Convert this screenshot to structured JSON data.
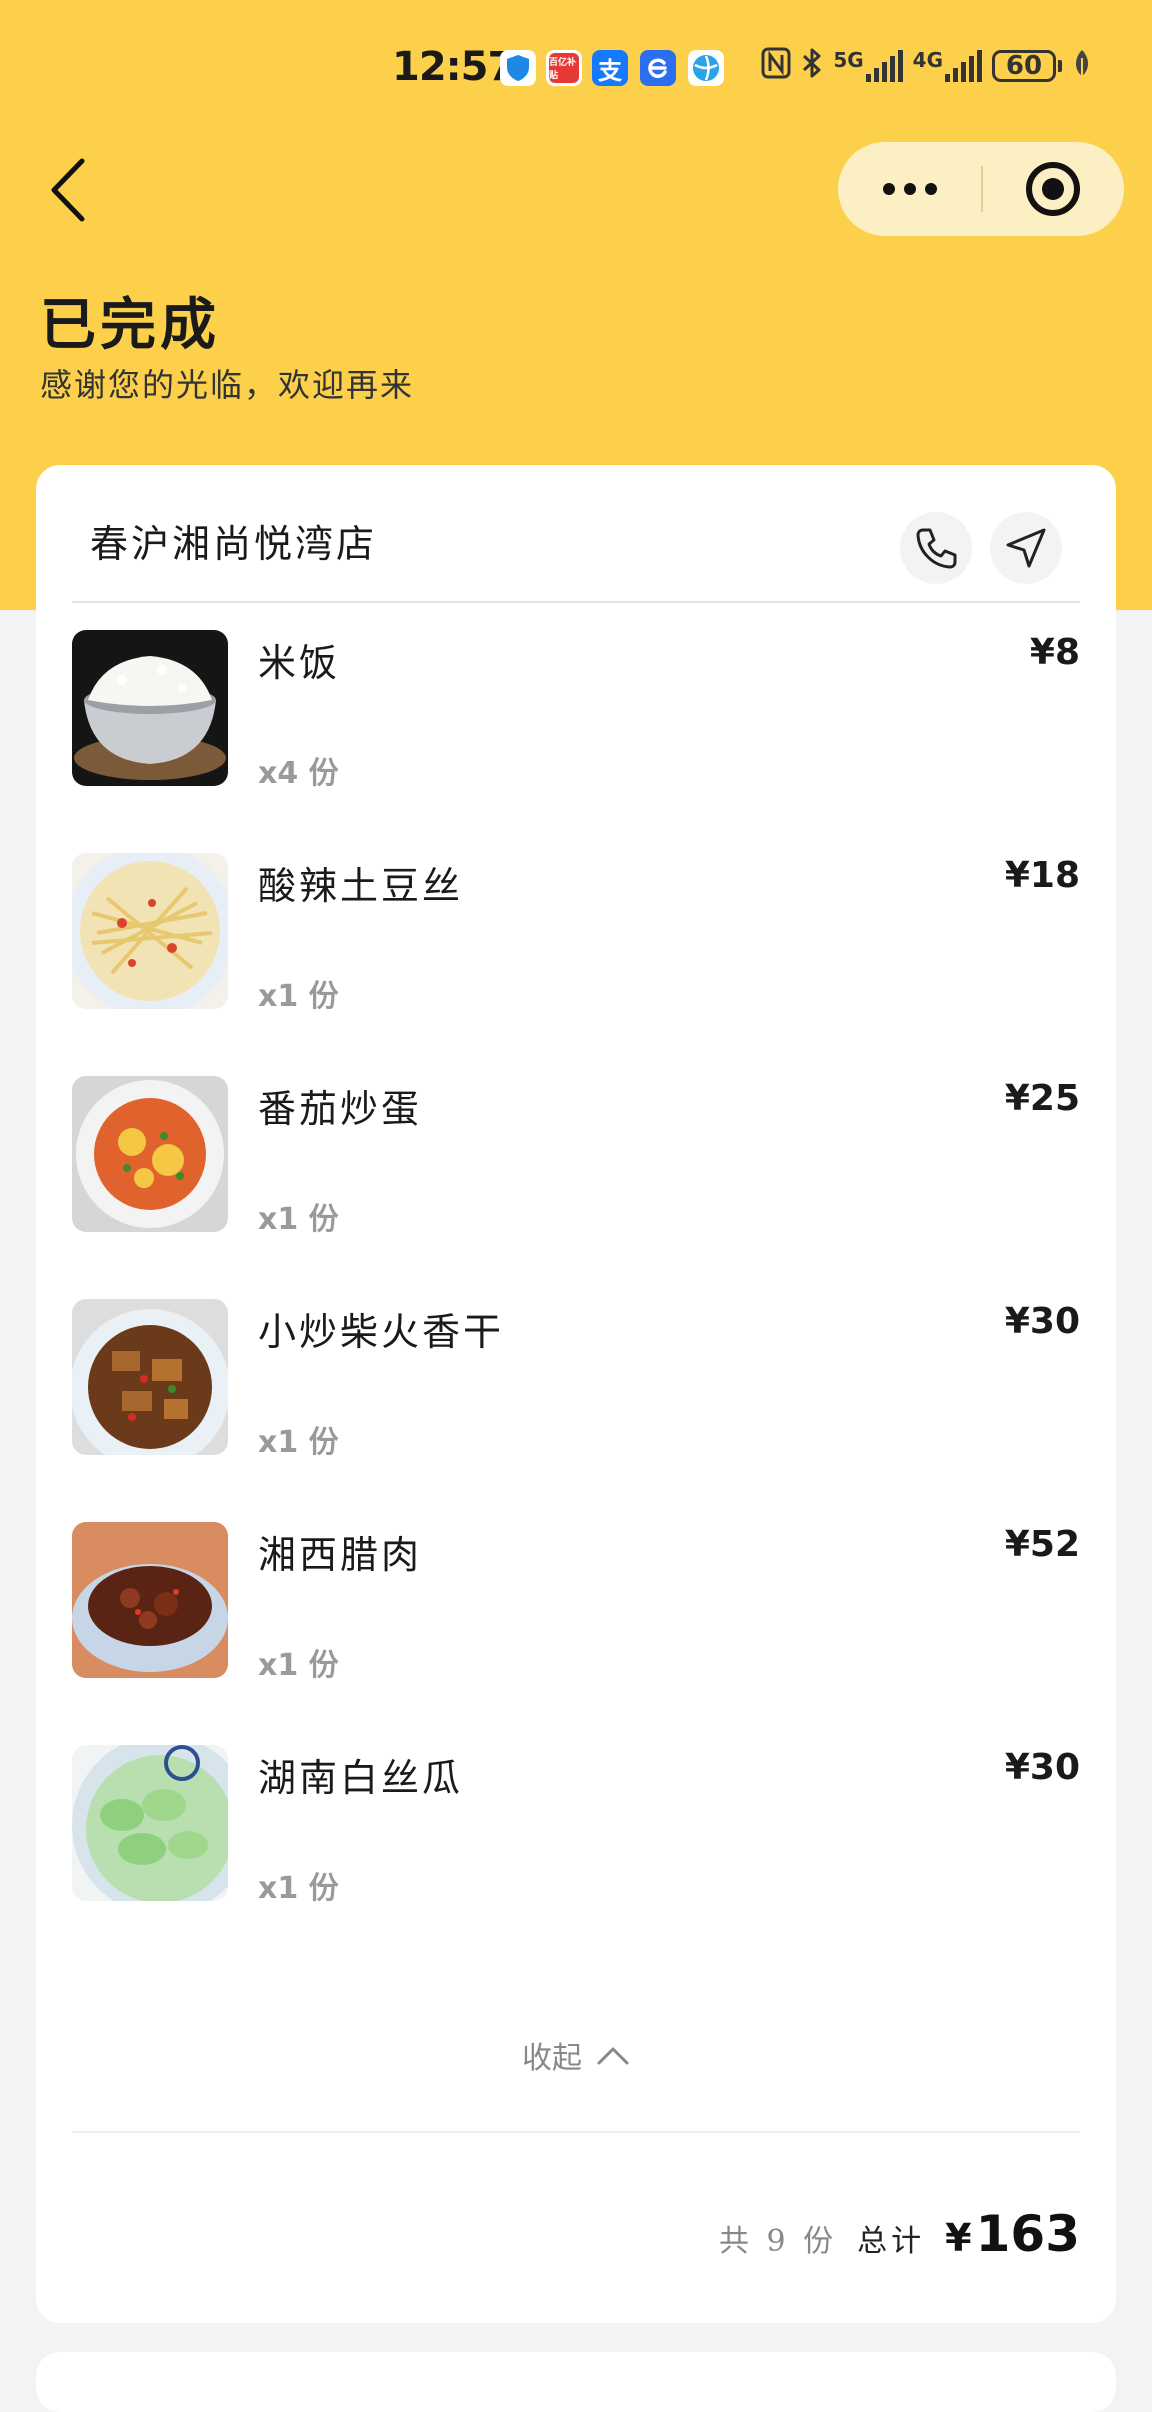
{
  "status_bar": {
    "time": "12:57",
    "app_icons": [
      {
        "name": "shield-app-icon",
        "color": "#1e88e5"
      },
      {
        "name": "taobao-app-icon",
        "color": "#e53935",
        "text": "百亿补贴"
      },
      {
        "name": "alipay-app-icon",
        "color": "#1677ff",
        "text": "支"
      },
      {
        "name": "e-app-icon",
        "color": "#2b6ff0"
      },
      {
        "name": "globe-app-icon",
        "color": "#29a3e8"
      }
    ],
    "network_5g": "5G",
    "network_4g": "4G",
    "battery": "60"
  },
  "header": {
    "status_title": "已完成",
    "status_subtitle": "感谢您的光临，欢迎再来"
  },
  "store": {
    "name": "春沪湘尚悦湾店"
  },
  "items": [
    {
      "name": "米饭",
      "qty": "x4 份",
      "price": "¥8"
    },
    {
      "name": "酸辣土豆丝",
      "qty": "x1 份",
      "price": "¥18"
    },
    {
      "name": "番茄炒蛋",
      "qty": "x1 份",
      "price": "¥25"
    },
    {
      "name": "小炒柴火香干",
      "qty": "x1 份",
      "price": "¥30"
    },
    {
      "name": "湘西腊肉",
      "qty": "x1 份",
      "price": "¥52"
    },
    {
      "name": "湖南白丝瓜",
      "qty": "x1 份",
      "price": "¥30"
    }
  ],
  "collapse_label": "收起",
  "summary": {
    "count_text": "共 9 份",
    "total_label": "总计",
    "currency": "¥",
    "total_value": "163"
  },
  "colors": {
    "header_yellow": "#fdd04b",
    "capsule_bg": "#fcefc4"
  }
}
